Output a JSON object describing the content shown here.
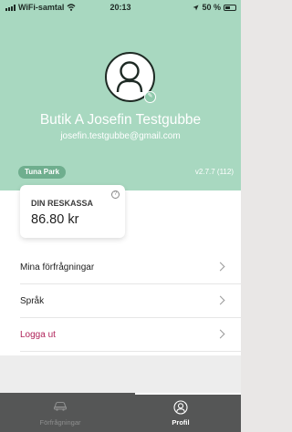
{
  "status_bar": {
    "carrier": "WiFi-samtal",
    "time": "20:13",
    "battery": "50 %"
  },
  "profile": {
    "name": "Butik A Josefin Testgubbe",
    "email": "josefin.testgubbe@gmail.com",
    "location": "Tuna Park",
    "version": "v2.7.7 (112)",
    "avatar_icon": "user-avatar-icon",
    "edit_icon": "edit-pencil-icon"
  },
  "reskassa": {
    "label": "DIN RESKASSA",
    "value": "86.80 kr",
    "info_icon": "info-icon"
  },
  "menu": {
    "items": [
      {
        "label": "Mina förfrågningar"
      },
      {
        "label": "Språk"
      },
      {
        "label": "Logga ut"
      }
    ]
  },
  "tabs": [
    {
      "label": "Förfrågningar",
      "icon": "car-icon"
    },
    {
      "label": "Profil",
      "icon": "profile-icon"
    }
  ],
  "colors": {
    "header": "#a8d8c0",
    "location_pill": "#6fae8e",
    "logout_text": "#b0235a",
    "tabbar": "#555656"
  }
}
